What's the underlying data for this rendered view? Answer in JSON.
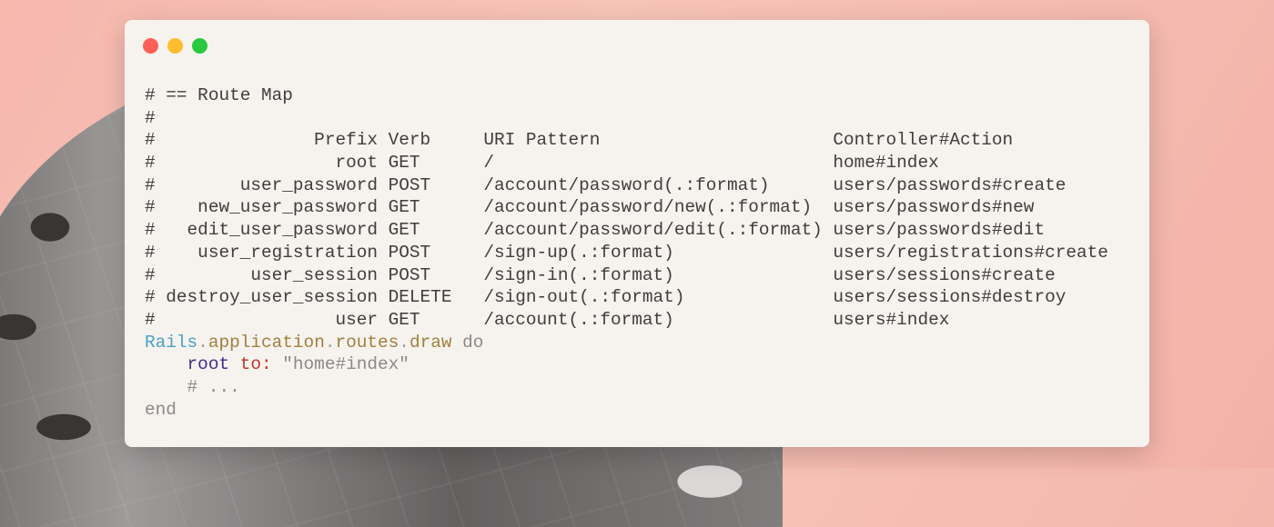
{
  "window": {
    "buttons": {
      "close": "close",
      "minimize": "minimize",
      "maximize": "maximize"
    }
  },
  "code": {
    "comment_lines": [
      "# == Route Map",
      "#",
      "#               Prefix Verb     URI Pattern                      Controller#Action",
      "#                 root GET      /                                home#index",
      "#        user_password POST     /account/password(.:format)      users/passwords#create",
      "#    new_user_password GET      /account/password/new(.:format)  users/passwords#new",
      "#   edit_user_password GET      /account/password/edit(.:format) users/passwords#edit",
      "#    user_registration POST     /sign-up(.:format)               users/registrations#create",
      "#         user_session POST     /sign-in(.:format)               users/sessions#create",
      "# destroy_user_session DELETE   /sign-out(.:format)              users/sessions#destroy",
      "#                 user GET      /account(.:format)               users#index"
    ],
    "draw_line": {
      "const": "Rails",
      "dot1": ".",
      "m1": "application",
      "dot2": ".",
      "m2": "routes",
      "dot3": ".",
      "m3": "draw",
      "kw": " do"
    },
    "root_line": {
      "indent": "    ",
      "call": "root",
      "symbol": " to:",
      "string": " \"home#index\""
    },
    "ellipsis_line": "    # ...",
    "end_line": "end"
  }
}
